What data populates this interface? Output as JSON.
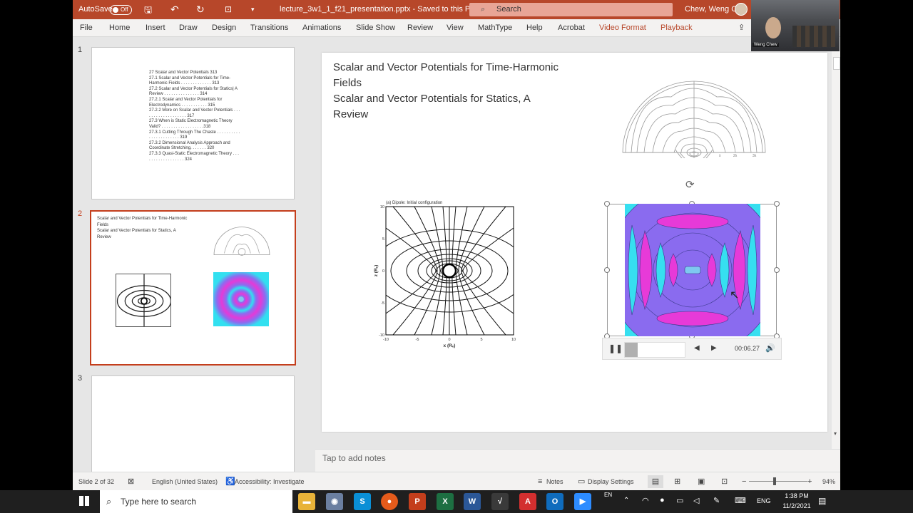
{
  "titlebar": {
    "autosave": "AutoSave",
    "toggle": "Off",
    "filename": "lecture_3w1_1_f21_presentation.pptx  -  Saved to this PC",
    "search_placeholder": "Search",
    "user": "Chew, Weng C"
  },
  "ribbon": {
    "tabs": [
      "File",
      "Home",
      "Insert",
      "Draw",
      "Design",
      "Transitions",
      "Animations",
      "Slide Show",
      "Review",
      "View",
      "MathType",
      "Help",
      "Acrobat",
      "Video Format",
      "Playback"
    ]
  },
  "thumbnails": {
    "num1": "1",
    "num2": "2",
    "num3": "3",
    "toc": [
      "27 Scalar and Vector Potentials 313",
      "27.1 Scalar and Vector Potentials for Time-",
      "Harmonic Fields . . . . . . . . . . . . . 313",
      "27.2 Scalar and Vector Potentials for Statics| A",
      "Review . . . . . . . . . . . . . . . 314",
      "27.2.1 Scalar and Vector Potentials for",
      "Electrodynamics . . . . . . . . . . . 315",
      "27.2.2 More on Scalar and Vector Potentials . . .",
      ". . . . . . . . . . . . . . . . 317",
      "27.3 When is Static Electromagnetic Theory",
      "Valid? . . . . . . . . . . . . . . . . . .318",
      "27.3.1 Cutting Through The Chaste . . . . . . . . . .",
      ". . . . . . . . . . . . . 319",
      "27.3.2 Dimensional Analysis Approach and",
      "Coordinate Stretching. . . . . . . 320",
      "27.3.3 Quasi-Static Electromagnetic Theory . . .",
      ". . . . . . . . . . . . . . . 324"
    ],
    "t2_line1": "Scalar and Vector Potentials for Time-Harmonic",
    "t2_line2": "Fields",
    "t2_line3": "Scalar and Vector Potentials for Statics, A",
    "t2_line4": "Review"
  },
  "slide": {
    "title_line1": "Scalar and Vector Potentials for Time-Harmonic",
    "title_line2": "Fields",
    "title_line3": "Scalar and Vector Potentials for Statics, A",
    "title_line4": "Review",
    "dipole_caption": "(a) Dipole: Initial configuration",
    "xlabel": "x (Rₑ)",
    "ylabel": "z (Rₑ)",
    "xticks": [
      "-10",
      "-5",
      "0",
      "5",
      "10"
    ],
    "yticks": [
      "10",
      "5",
      "0",
      "-5",
      "-10"
    ],
    "semi_labels": [
      "λ",
      "2λ",
      "3λ"
    ],
    "video_time": "00:06.27",
    "video_progress": 0.21
  },
  "notes": {
    "placeholder": "Tap to add notes"
  },
  "status": {
    "slide": "Slide 2 of 32",
    "language": "English (United States)",
    "accessibility": "Accessibility: Investigate",
    "notes": "Notes",
    "display": "Display Settings",
    "zoom": "94%"
  },
  "taskbar": {
    "search_placeholder": "Type here to search",
    "lang": "ENG",
    "lang2": "EN",
    "time": "1:38 PM",
    "date": "11/2/2021"
  },
  "video": {
    "name": "Weng Chew"
  }
}
